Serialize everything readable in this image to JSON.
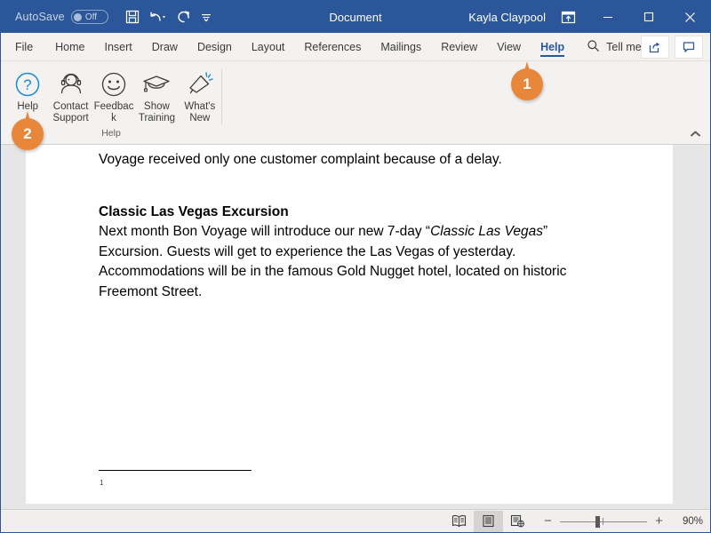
{
  "titlebar": {
    "autosave_label": "AutoSave",
    "autosave_state": "Off",
    "quick_access": [
      {
        "name": "save-icon",
        "tooltip": "Save"
      },
      {
        "name": "undo-icon",
        "tooltip": "Undo"
      },
      {
        "name": "redo-icon",
        "tooltip": "Redo"
      },
      {
        "name": "customize-quick-access-toolbar-icon",
        "tooltip": "Customize Quick Access Toolbar"
      }
    ],
    "document_title": "Document",
    "user_name": "Kayla Claypool",
    "ribbon_display_options": "ribbon-display-options-icon",
    "window_controls": {
      "minimize": "—",
      "maximize": "□",
      "close": "✕"
    }
  },
  "tabs": [
    {
      "label": "File",
      "active": false
    },
    {
      "label": "Home",
      "active": false
    },
    {
      "label": "Insert",
      "active": false
    },
    {
      "label": "Draw",
      "active": false
    },
    {
      "label": "Design",
      "active": false
    },
    {
      "label": "Layout",
      "active": false
    },
    {
      "label": "References",
      "active": false
    },
    {
      "label": "Mailings",
      "active": false
    },
    {
      "label": "Review",
      "active": false
    },
    {
      "label": "View",
      "active": false
    },
    {
      "label": "Help",
      "active": true
    }
  ],
  "tellme": {
    "icon": "search-icon",
    "label": "Tell me"
  },
  "tabs_right": {
    "share_label": "Share",
    "comments_label": "Comments"
  },
  "ribbon": {
    "group_label": "Help",
    "buttons": [
      {
        "label": "Help",
        "icon": "question-mark-circle-icon"
      },
      {
        "label": "Contact Support",
        "icon": "headset-person-icon"
      },
      {
        "label": "Feedback",
        "icon": "smiley-face-icon"
      },
      {
        "label": "Show Training",
        "icon": "graduation-cap-icon"
      },
      {
        "label": "What's New",
        "icon": "megaphone-icon"
      }
    ],
    "collapse_icon": "chevron-up-icon"
  },
  "document": {
    "paragraph_1": "Voyage received only one customer complaint because of a delay.",
    "heading_1": "Classic Las Vegas Excursion",
    "paragraph_2_part1": "Next month Bon Voyage will introduce our new 7-day “",
    "paragraph_2_italic": "Classic Las Vegas",
    "paragraph_2_part2": "” Excursion. Guests will get to experience the Las Vegas of yesterday. Accommodations will be in the famous Gold Nugget hotel, located on historic Freemont Street.",
    "footnote_number": "1"
  },
  "statusbar": {
    "view_buttons": [
      {
        "name": "read-mode-icon",
        "label": "Read Mode",
        "selected": false
      },
      {
        "name": "print-layout-icon",
        "label": "Print Layout",
        "selected": true
      },
      {
        "name": "web-layout-icon",
        "label": "Web Layout",
        "selected": false
      }
    ],
    "zoom_out": "−",
    "zoom_in": "+",
    "zoom_level": "90%"
  },
  "callouts": [
    {
      "number": "1"
    },
    {
      "number": "2"
    }
  ],
  "colors": {
    "titlebar_blue": "#2b579a",
    "accent_orange": "#e8873a",
    "ribbon_gray": "#f3f2f1",
    "canvas_gray": "#e6e6e6"
  }
}
